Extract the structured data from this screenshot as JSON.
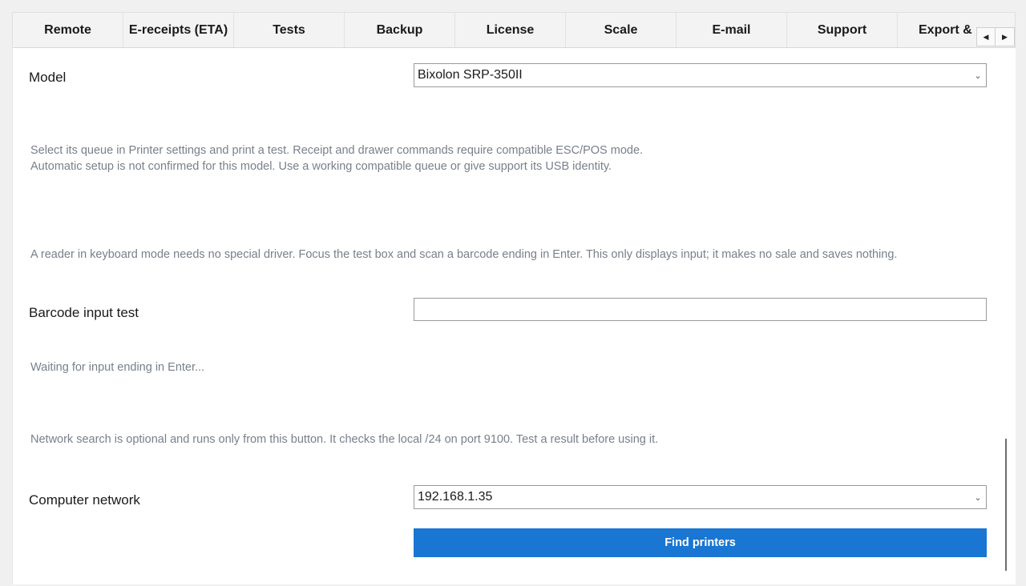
{
  "tabs": [
    {
      "label": "Remote"
    },
    {
      "label": "E-receipts (ETA)"
    },
    {
      "label": "Tests"
    },
    {
      "label": "Backup"
    },
    {
      "label": "License"
    },
    {
      "label": "Scale"
    },
    {
      "label": "E-mail"
    },
    {
      "label": "Support"
    },
    {
      "label": "Export &"
    }
  ],
  "tab_scroll": {
    "left_glyph": "◀",
    "right_glyph": "▶"
  },
  "printer": {
    "model_label": "Model",
    "model_value": "Bixolon SRP-350II",
    "hint_line1": "Select its queue in Printer settings and print a test. Receipt and drawer commands require compatible ESC/POS mode.",
    "hint_line2": "Automatic setup is not confirmed for this model. Use a working compatible queue or give support its USB identity."
  },
  "barcode": {
    "hint": "A reader in keyboard mode needs no special driver. Focus the test box and scan a barcode ending in Enter. This only displays input; it makes no sale and saves nothing.",
    "label": "Barcode input test",
    "input_value": "",
    "status": "Waiting for input ending in Enter..."
  },
  "network": {
    "hint": "Network search is optional and runs only from this button. It checks the local /24 on port 9100. Test a result before using it.",
    "label": "Computer network",
    "value": "192.168.1.35",
    "find_button": "Find printers"
  },
  "icons": {
    "dropdown": "chevron-down-icon",
    "scroll_left": "arrow-left-icon",
    "scroll_right": "arrow-right-icon"
  },
  "colors": {
    "accent": "#1976d2",
    "hint_text": "#78808c",
    "background": "#f0f0f0"
  }
}
